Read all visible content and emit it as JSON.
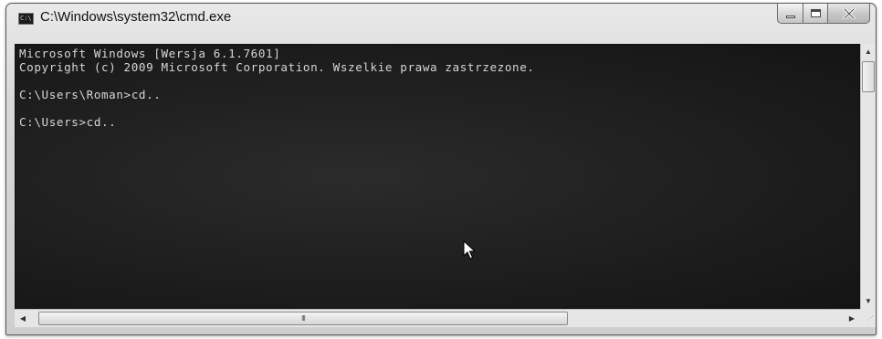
{
  "window": {
    "title": "C:\\Windows\\system32\\cmd.exe",
    "app_icon_text": "C:\\"
  },
  "console": {
    "lines": [
      "Microsoft Windows [Wersja 6.1.7601]",
      "Copyright (c) 2009 Microsoft Corporation. Wszelkie prawa zastrzezone.",
      "",
      "C:\\Users\\Roman>cd..",
      "",
      "C:\\Users>cd.."
    ],
    "text_color": "#d6d6d6",
    "background_color": "#1d1d1d"
  },
  "scrollbars": {
    "horizontal_thumb_grip": "III"
  },
  "icons": {
    "minimize": "minimize-icon",
    "maximize": "maximize-icon",
    "close": "close-icon",
    "scroll_up": "arrow-up-icon",
    "scroll_down": "arrow-down-icon",
    "scroll_left": "arrow-left-icon",
    "scroll_right": "arrow-right-icon"
  }
}
